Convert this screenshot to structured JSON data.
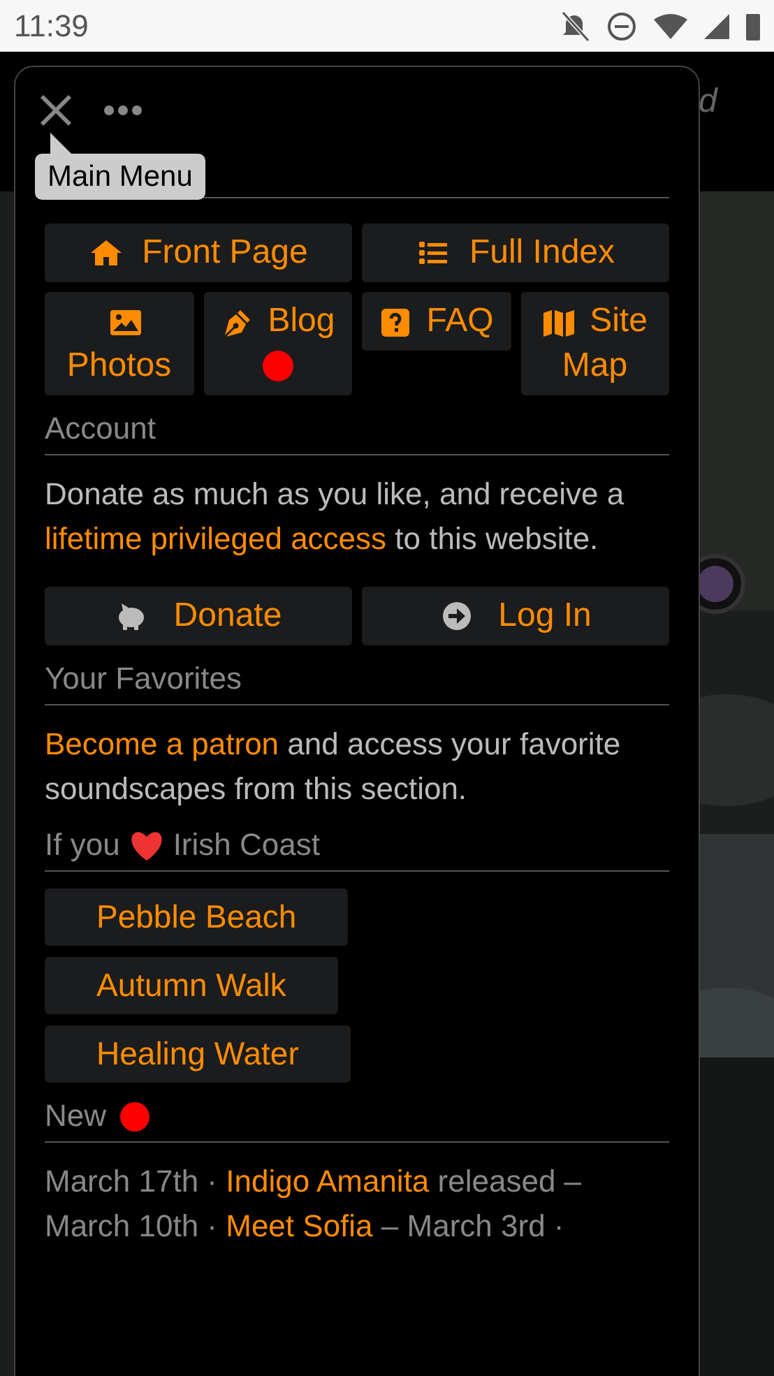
{
  "status_bar": {
    "time": "11:39"
  },
  "background_fragment": "d",
  "menu": {
    "tooltip": "Main Menu",
    "nav_buttons": [
      {
        "label": "Front Page",
        "new": false
      },
      {
        "label": "Full Index",
        "new": false
      },
      {
        "label": "Photos",
        "new": false
      },
      {
        "label": "Blog",
        "new": true
      },
      {
        "label": "FAQ",
        "new": false
      },
      {
        "label": "Site Map",
        "new": false
      }
    ],
    "account": {
      "heading": "Account",
      "text_before": "Donate as much as you like, and receive a ",
      "link": "lifetime privileged access",
      "text_after": " to this website.",
      "buttons": [
        {
          "label": "Donate"
        },
        {
          "label": "Log In"
        }
      ]
    },
    "favorites": {
      "heading": "Your Favorites",
      "link": "Become a patron",
      "text_after": " and access your favorite soundscapes from this section."
    },
    "related": {
      "heading_before": "If you",
      "heading_after": "Irish Coast",
      "items": [
        "Pebble Beach",
        "Autumn Walk",
        "Healing Water"
      ]
    },
    "news": {
      "heading": "New",
      "new": true,
      "entries": [
        {
          "date": "March 17th ·",
          "link": "Indigo Amanita",
          "after": "released –"
        },
        {
          "date": "March 10th ·",
          "link": "Meet Sofia",
          "after": "– March 3rd ·"
        }
      ]
    }
  }
}
